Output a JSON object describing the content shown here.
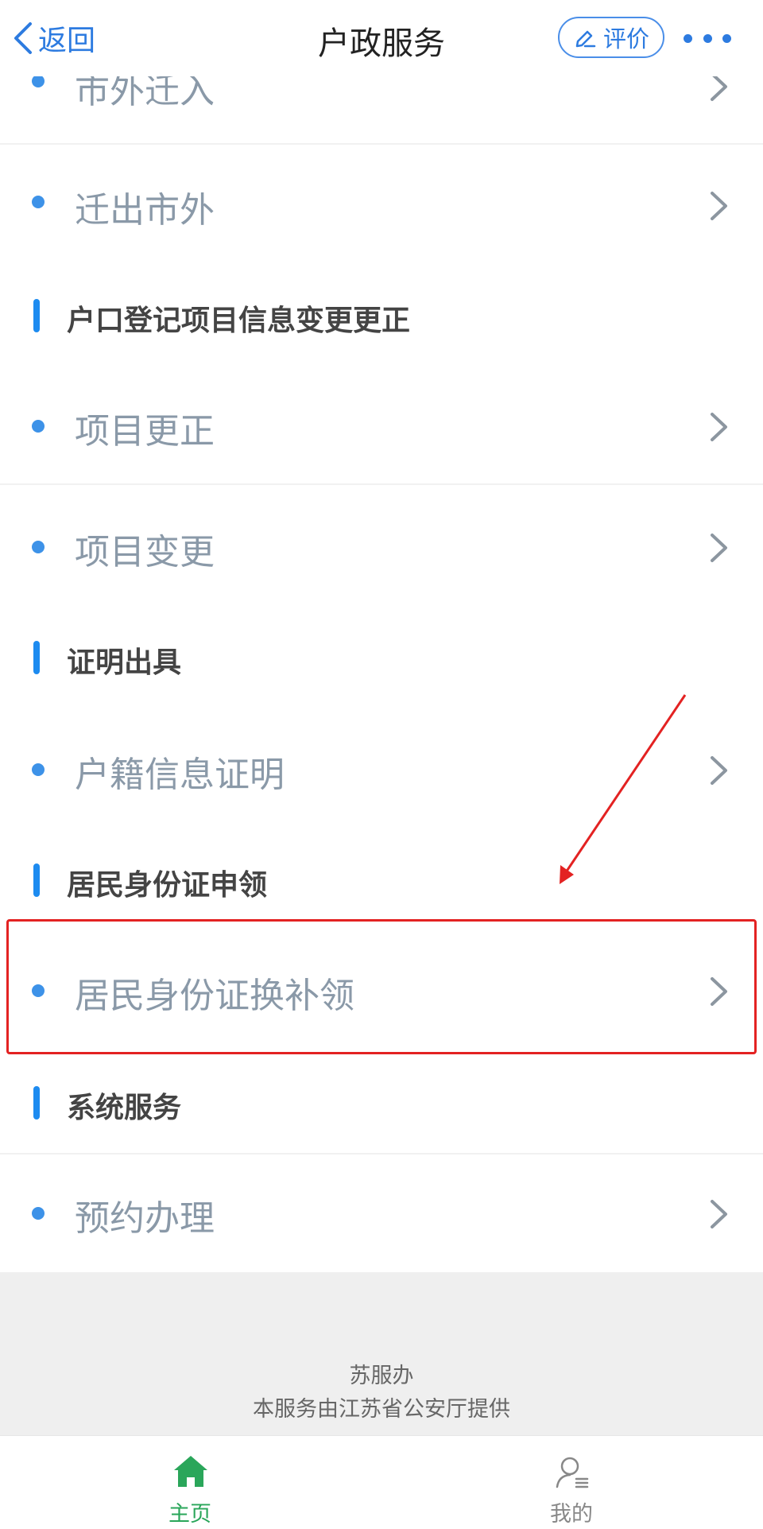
{
  "header": {
    "back_label": "返回",
    "title": "户政服务",
    "rate_label": "评价"
  },
  "sections": [
    {
      "title": "户口登记项目信息变更更正",
      "items": [
        "项目更正",
        "项目变更"
      ]
    },
    {
      "title": "证明出具",
      "items": [
        "户籍信息证明"
      ]
    },
    {
      "title": "居民身份证申领",
      "items": [
        "居民身份证换补领"
      ]
    },
    {
      "title": "系统服务",
      "items": [
        "预约办理"
      ]
    }
  ],
  "top_items": [
    "市外迁入",
    "迁出市外"
  ],
  "footer": {
    "line1": "苏服办",
    "line2": "本服务由江苏省公安厅提供"
  },
  "tabbar": {
    "home_label": "主页",
    "mine_label": "我的"
  },
  "colors": {
    "accent_blue": "#2d7be0",
    "dot_blue": "#3d92e8",
    "section_bar": "#1d8bf0",
    "item_text": "#8a99a8",
    "home_green": "#2aa65a",
    "highlight_red": "#e32222"
  },
  "annotation": {
    "highlighted_item": "居民身份证换补领"
  }
}
